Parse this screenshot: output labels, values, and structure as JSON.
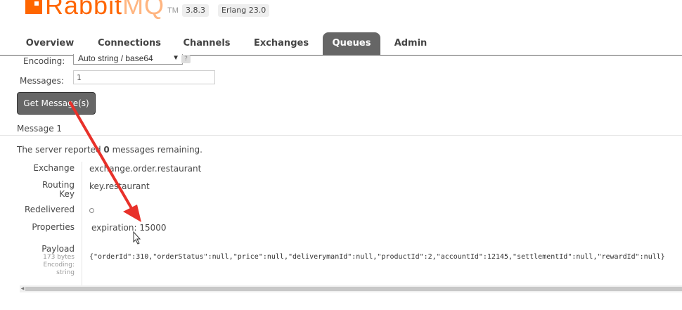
{
  "logo": {
    "name_primary": "Rabbit",
    "name_secondary": "MQ",
    "tm": "TM"
  },
  "versions": {
    "rabbitmq": "3.8.3",
    "erlang": "Erlang 23.0"
  },
  "tabs": [
    {
      "label": "Overview",
      "active": false
    },
    {
      "label": "Connections",
      "active": false
    },
    {
      "label": "Channels",
      "active": false
    },
    {
      "label": "Exchanges",
      "active": false
    },
    {
      "label": "Queues",
      "active": true
    },
    {
      "label": "Admin",
      "active": false
    }
  ],
  "form": {
    "encoding_label": "Encoding:",
    "encoding_value": "Auto string / base64",
    "help": "?",
    "messages_label": "Messages:",
    "messages_value": "1",
    "get_button": "Get Message(s)"
  },
  "message": {
    "header": "Message 1",
    "remaining_prefix": "The server reported ",
    "remaining_count": "0",
    "remaining_suffix": " messages remaining.",
    "rows": {
      "exchange_label": "Exchange",
      "exchange_value": "exchange.order.restaurant",
      "routing_label_1": "Routing",
      "routing_label_2": "Key",
      "routing_value": "key.restaurant",
      "redelivered_label": "Redelivered",
      "properties_label": "Properties",
      "properties_key": "expiration:",
      "properties_value": "15000",
      "payload_label": "Payload",
      "payload_size": "173 bytes",
      "payload_encoding_label": "Encoding:",
      "payload_encoding_value": "string",
      "payload_value": "{\"orderId\":310,\"orderStatus\":null,\"price\":null,\"deliverymanId\":null,\"productId\":2,\"accountId\":12145,\"settlementId\":null,\"rewardId\":null}"
    }
  },
  "colors": {
    "brand_orange": "#ff6600",
    "tab_active_bg": "#666666",
    "annotation_red": "#e8312a"
  }
}
